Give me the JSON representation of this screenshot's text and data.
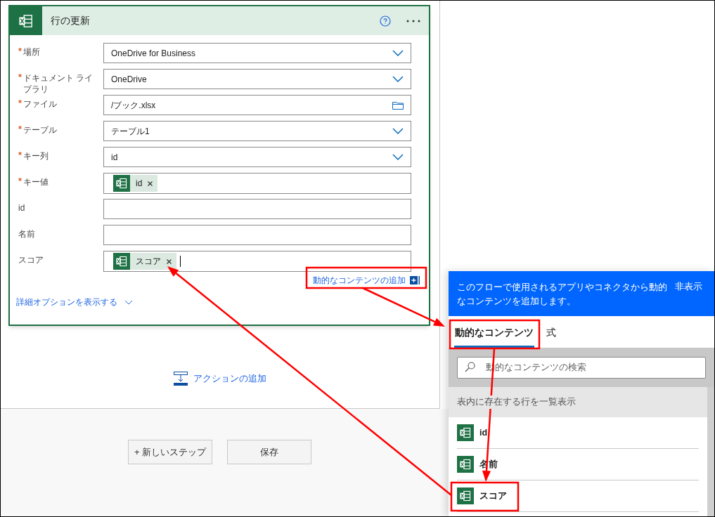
{
  "card": {
    "title": "行の更新",
    "fields": [
      {
        "label": "場所",
        "required": true,
        "kind": "dropdown",
        "value": "OneDrive for Business"
      },
      {
        "label": "ドキュメント ライブラリ",
        "required": true,
        "kind": "dropdown",
        "value": "OneDrive"
      },
      {
        "label": "ファイル",
        "required": true,
        "kind": "file",
        "value": "/ブック.xlsx"
      },
      {
        "label": "テーブル",
        "required": true,
        "kind": "dropdown",
        "value": "テーブル1"
      },
      {
        "label": "キー列",
        "required": true,
        "kind": "dropdown",
        "value": "id"
      },
      {
        "label": "キー値",
        "required": true,
        "kind": "tokens",
        "tokens": [
          "id"
        ],
        "cursor": false
      },
      {
        "label": "id",
        "required": false,
        "kind": "text"
      },
      {
        "label": "名前",
        "required": false,
        "kind": "text"
      },
      {
        "label": "スコア",
        "required": false,
        "kind": "tokens",
        "tokens": [
          "スコア"
        ],
        "cursor": true
      }
    ],
    "add_dynamic_content": "動的なコンテンツの追加",
    "advanced_options": "詳細オプションを表示する"
  },
  "add_action": "アクションの追加",
  "buttons": [
    "+ 新しいステップ",
    "保存"
  ],
  "panel": {
    "description": "このフローで使用されるアプリやコネクタから動的なコンテンツを追加します。",
    "hide": "非表示",
    "tabs": [
      {
        "label": "動的なコンテンツ",
        "selected": true
      },
      {
        "label": "式",
        "selected": false
      }
    ],
    "search": {
      "placeholder": "動的なコンテンツの検索"
    },
    "section": "表内に存在する行を一覧表示",
    "items": [
      "id",
      "名前",
      "スコア"
    ]
  }
}
